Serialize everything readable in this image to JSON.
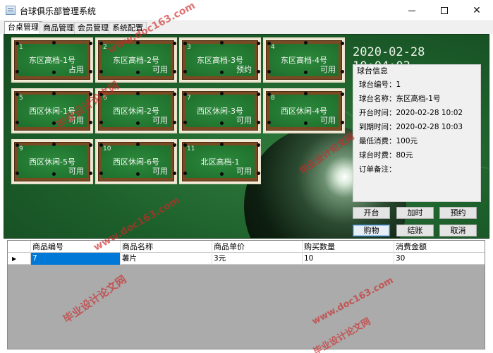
{
  "window": {
    "title": "台球俱乐部管理系统",
    "minimize_icon": "minimize-icon",
    "maximize_icon": "maximize-icon",
    "close_icon": "close-icon",
    "close_glyph": "✕"
  },
  "tabs": [
    {
      "label": "台桌管理",
      "active": true
    },
    {
      "label": "商品管理",
      "active": false
    },
    {
      "label": "会员管理",
      "active": false
    },
    {
      "label": "系统配置",
      "active": false
    }
  ],
  "clock": "2020-02-28 10:04:03",
  "tables": [
    {
      "no": "1",
      "name": "东区高档-1号",
      "status": "占用"
    },
    {
      "no": "2",
      "name": "东区高档-2号",
      "status": "可用"
    },
    {
      "no": "3",
      "name": "东区高档-3号",
      "status": "预约"
    },
    {
      "no": "4",
      "name": "东区高档-4号",
      "status": "可用"
    },
    {
      "no": "5",
      "name": "西区休闲-1号",
      "status": "可用"
    },
    {
      "no": "6",
      "name": "西区休闲-2号",
      "status": "可用"
    },
    {
      "no": "7",
      "name": "西区休闲-3号",
      "status": "可用"
    },
    {
      "no": "8",
      "name": "西区休闲-4号",
      "status": "可用"
    },
    {
      "no": "9",
      "name": "西区休闲-5号",
      "status": "可用"
    },
    {
      "no": "10",
      "name": "西区休闲-6号",
      "status": "可用"
    },
    {
      "no": "11",
      "name": "北区高档-1",
      "status": "可用"
    }
  ],
  "info": {
    "title": "球台信息",
    "rows": [
      "球台编号：1",
      "球台名称：东区高档-1号",
      "开台时间：2020-02-28 10:02",
      "到期时间：2020-02-28 10:03",
      "最低消费：100元",
      "球台时费：80元",
      "订单备注："
    ]
  },
  "actions": {
    "open": "开台",
    "extend": "加时",
    "reserve": "预约",
    "buy": "购物",
    "checkout": "结账",
    "cancel": "取消"
  },
  "grid": {
    "columns": [
      "商品编号",
      "商品名称",
      "商品单价",
      "购买数量",
      "消费金额"
    ],
    "row_marker": "▶",
    "rows": [
      [
        "7",
        "薯片",
        "3元",
        "10",
        "30"
      ]
    ]
  },
  "watermarks": {
    "brand": "毕业设计论文网",
    "site": "www.doc163.com"
  },
  "colors": {
    "felt_green": "#1d5f2b",
    "selection_blue": "#0078d7",
    "watermark_red": "#cd2828"
  }
}
